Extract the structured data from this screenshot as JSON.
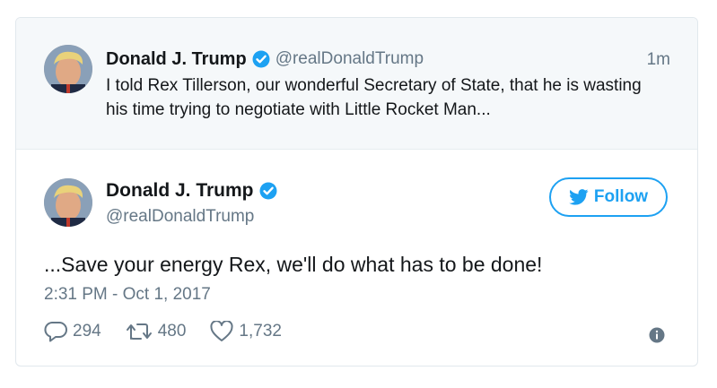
{
  "parent_tweet": {
    "author_name": "Donald J. Trump",
    "author_handle": "@realDonaldTrump",
    "time": "1m",
    "text": "I told Rex Tillerson, our wonderful Secretary of State, that he is wasting his time trying to negotiate with Little Rocket Man..."
  },
  "main_tweet": {
    "author_name": "Donald J. Trump",
    "author_handle": "@realDonaldTrump",
    "follow_label": "Follow",
    "text": "...Save your energy Rex, we'll do what has to be done!",
    "timestamp": "2:31 PM - Oct 1, 2017",
    "replies": "294",
    "retweets": "480",
    "likes": "1,732"
  },
  "icons": {
    "verified": "verified-badge-icon",
    "bird": "twitter-bird-icon",
    "reply": "reply-icon",
    "retweet": "retweet-icon",
    "like": "heart-icon",
    "info": "info-icon"
  },
  "colors": {
    "accent": "#1da1f2",
    "muted": "#657786",
    "text": "#14171a",
    "parent_bg": "#f5f8fa"
  }
}
